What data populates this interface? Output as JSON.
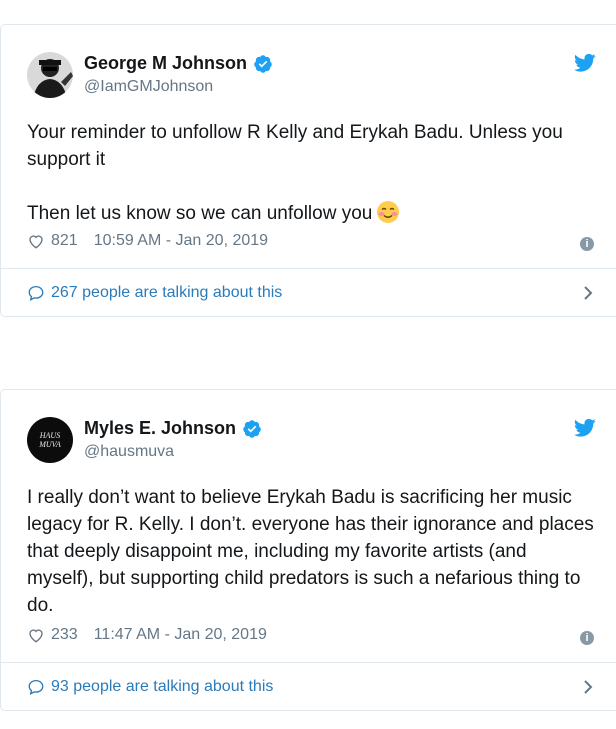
{
  "tweets": [
    {
      "name": "George M Johnson",
      "handle": "@IamGMJohnson",
      "text": "Your reminder to unfollow R Kelly and Erykah Badu. Unless you support it\n\nThen let us know so we can unfollow you",
      "emoji": "smiling-face-with-blush",
      "likes": "821",
      "timestamp": "10:59 AM - Jan 20, 2019",
      "talking": "267 people are talking about this",
      "avatar": "george-photo"
    },
    {
      "name": "Myles E. Johnson",
      "handle": "@hausmuva",
      "text": "I really don’t want to believe Erykah Badu is sacrificing her music legacy for R. Kelly. I don’t. everyone has their ignorance and places that deeply disappoint me, including my favorite artists (and myself), but supporting child predators is such a nefarious thing to do.",
      "likes": "233",
      "timestamp": "11:47 AM - Jan 20, 2019",
      "talking": "93 people are talking about this",
      "avatar_text": "HAUS MUVA"
    }
  ],
  "colors": {
    "twitter_blue": "#1da1f2",
    "link_blue": "#2b7bb9",
    "meta_gray": "#657786",
    "border": "#e1e8ed"
  }
}
